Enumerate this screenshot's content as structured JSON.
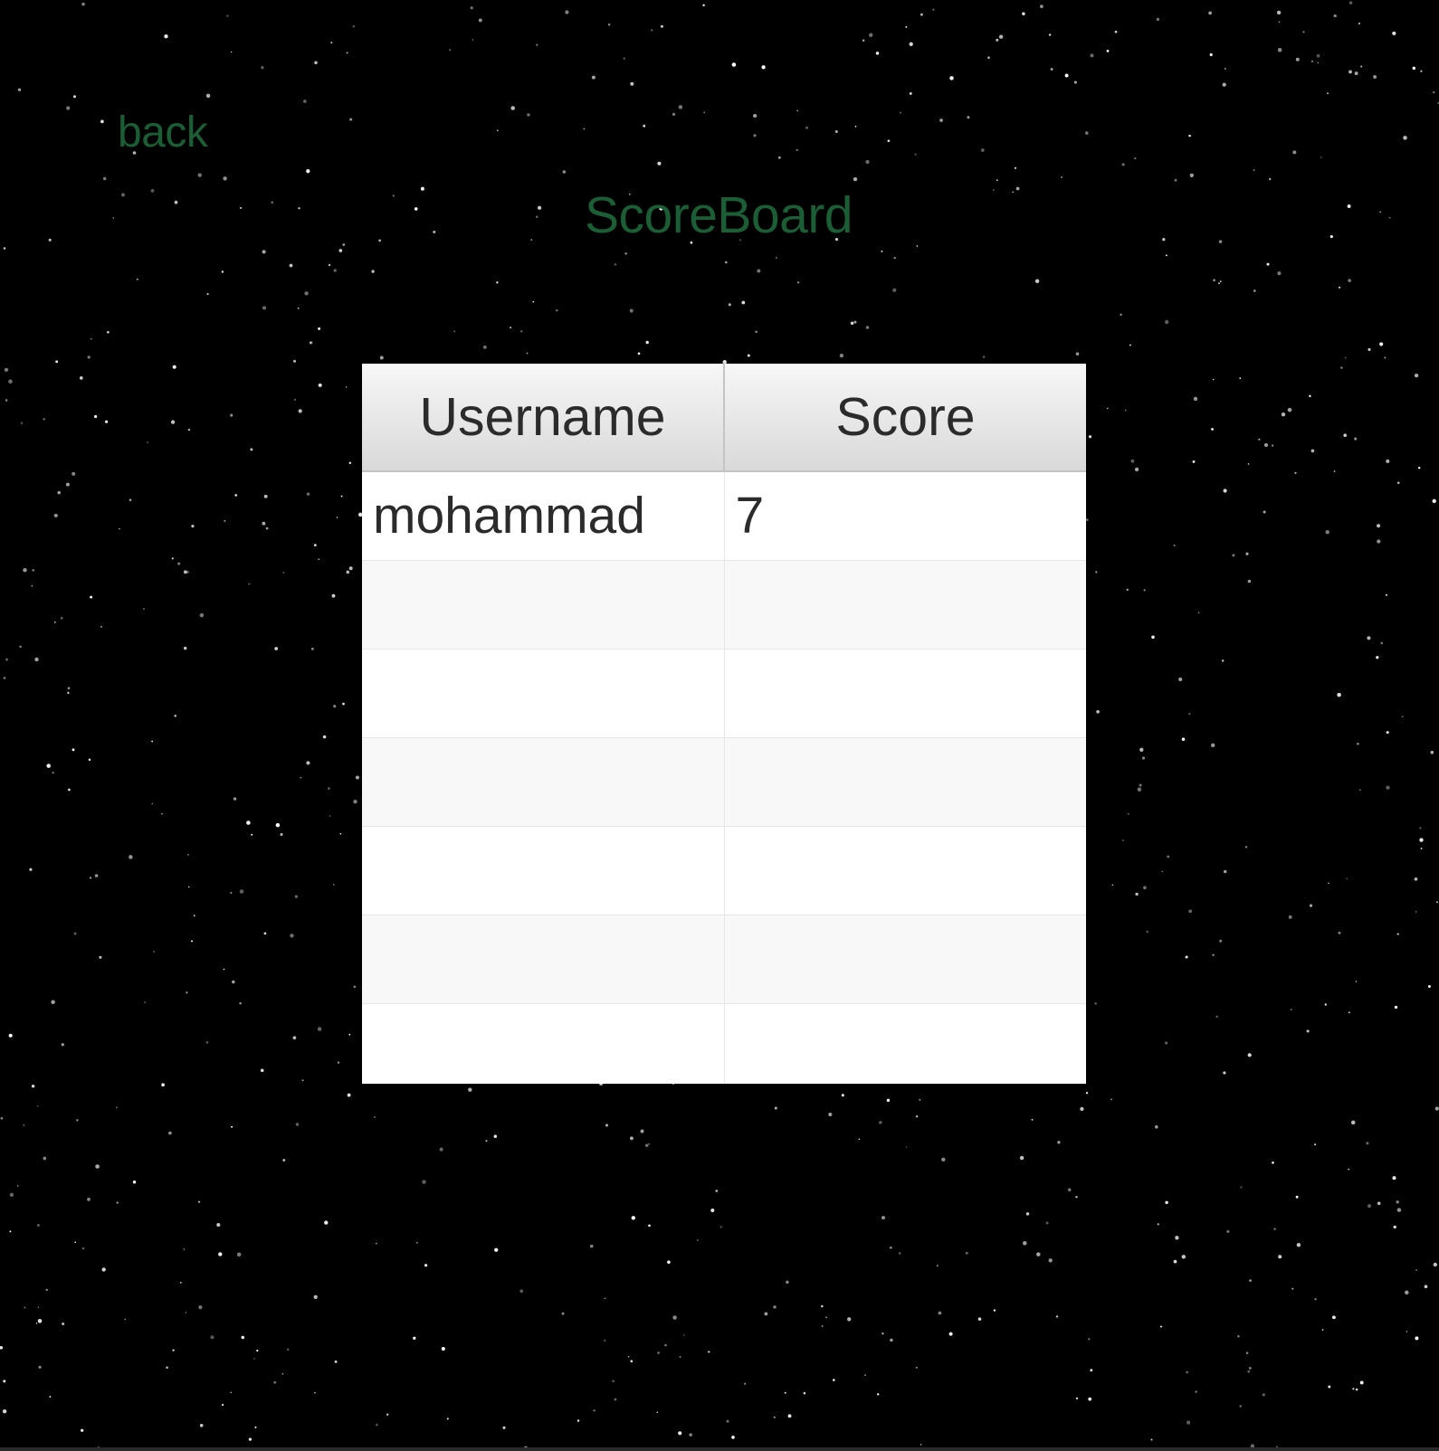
{
  "theme": {
    "background": "#000000",
    "accent_green": "#1b5e35",
    "header_text": "#2b2b2b"
  },
  "nav": {
    "back_label": "back"
  },
  "page": {
    "title": "ScoreBoard"
  },
  "scoreboard": {
    "columns": [
      "Username",
      "Score"
    ],
    "rows": [
      {
        "username": "mohammad",
        "score": "7"
      },
      {
        "username": "",
        "score": ""
      },
      {
        "username": "",
        "score": ""
      },
      {
        "username": "",
        "score": ""
      },
      {
        "username": "",
        "score": ""
      },
      {
        "username": "",
        "score": ""
      },
      {
        "username": "",
        "score": ""
      }
    ]
  }
}
